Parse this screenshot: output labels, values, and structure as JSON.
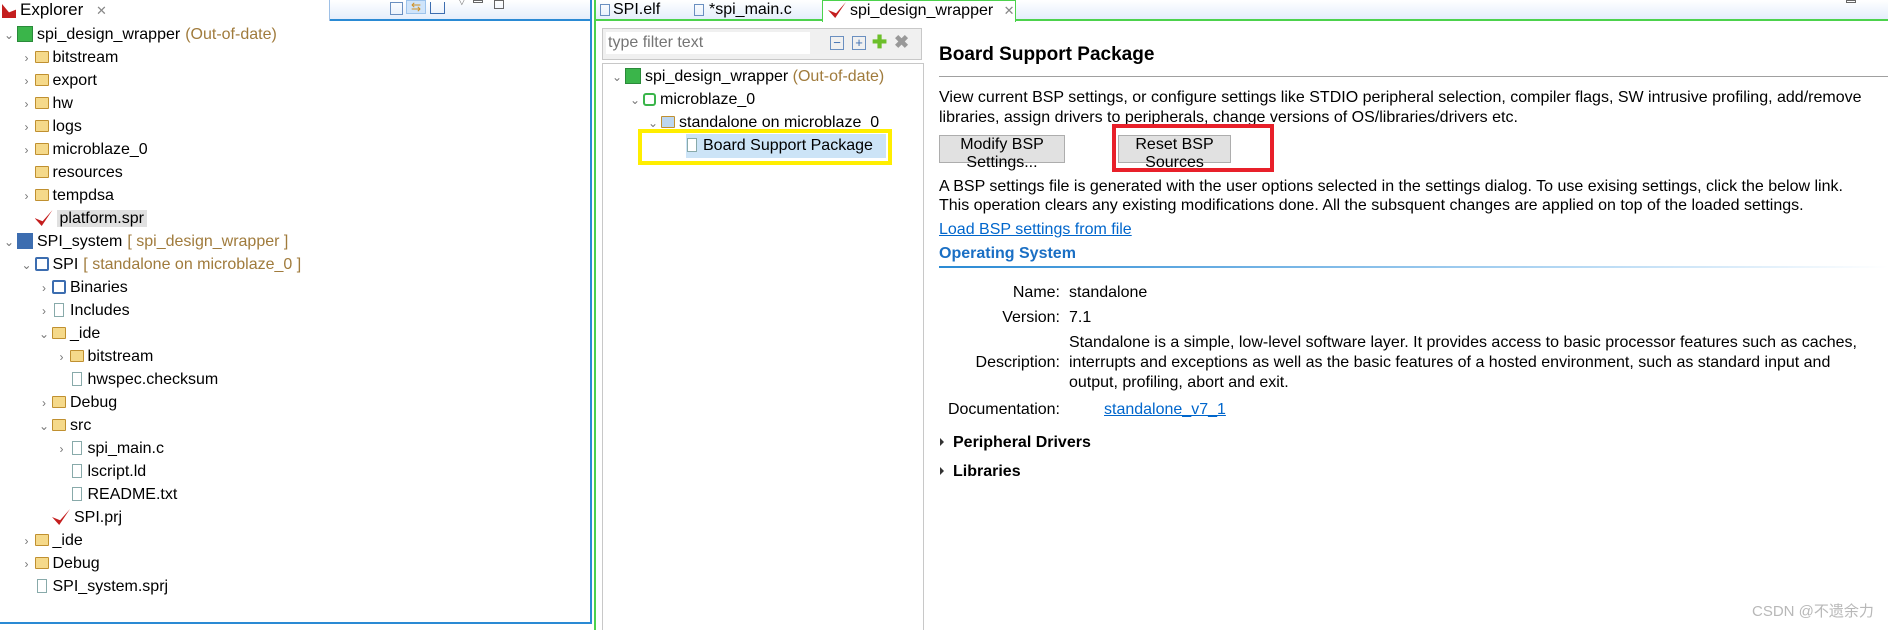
{
  "explorer": {
    "tab_label": "Explorer",
    "tree": [
      {
        "label": "spi_design_wrapper",
        "suffix": "(Out-of-date)",
        "level": 0,
        "expand": "open",
        "icon": "platform-project-icon"
      },
      {
        "label": "bitstream",
        "level": 1,
        "expand": "closed",
        "icon": "folder-icon"
      },
      {
        "label": "export",
        "level": 1,
        "expand": "closed",
        "icon": "folder-icon"
      },
      {
        "label": "hw",
        "level": 1,
        "expand": "closed",
        "icon": "folder-icon"
      },
      {
        "label": "logs",
        "level": 1,
        "expand": "closed",
        "icon": "folder-icon"
      },
      {
        "label": "microblaze_0",
        "level": 1,
        "expand": "closed",
        "icon": "folder-icon"
      },
      {
        "label": "resources",
        "level": 1,
        "expand": "none",
        "icon": "folder-icon"
      },
      {
        "label": "tempdsa",
        "level": 1,
        "expand": "closed",
        "icon": "folder-icon"
      },
      {
        "label": "platform.spr",
        "level": 1,
        "expand": "none",
        "icon": "xilinx-file-icon",
        "selected": true
      },
      {
        "label": "SPI_system",
        "suffix": "[ spi_design_wrapper ]",
        "level": 0,
        "expand": "open",
        "icon": "system-project-icon"
      },
      {
        "label": "SPI",
        "suffix": "[ standalone on microblaze_0 ]",
        "level": 1,
        "expand": "open",
        "icon": "application-project-icon"
      },
      {
        "label": "Binaries",
        "level": 2,
        "expand": "closed",
        "icon": "binaries-icon"
      },
      {
        "label": "Includes",
        "level": 2,
        "expand": "closed",
        "icon": "includes-icon"
      },
      {
        "label": "_ide",
        "level": 2,
        "expand": "open",
        "icon": "folder-icon"
      },
      {
        "label": "bitstream",
        "level": 3,
        "expand": "closed",
        "icon": "folder-icon"
      },
      {
        "label": "hwspec.checksum",
        "level": 3,
        "expand": "none",
        "icon": "file-icon"
      },
      {
        "label": "Debug",
        "level": 2,
        "expand": "closed",
        "icon": "folder-icon"
      },
      {
        "label": "src",
        "level": 2,
        "expand": "open",
        "icon": "folder-icon"
      },
      {
        "label": "spi_main.c",
        "level": 3,
        "expand": "closed",
        "icon": "c-file-icon"
      },
      {
        "label": "lscript.ld",
        "level": 3,
        "expand": "none",
        "icon": "linker-script-icon"
      },
      {
        "label": "README.txt",
        "level": 3,
        "expand": "none",
        "icon": "file-icon"
      },
      {
        "label": "SPI.prj",
        "level": 2,
        "expand": "none",
        "icon": "project-settings-icon"
      },
      {
        "label": "_ide",
        "level": 1,
        "expand": "closed",
        "icon": "folder-icon"
      },
      {
        "label": "Debug",
        "level": 1,
        "expand": "closed",
        "icon": "folder-icon"
      },
      {
        "label": "SPI_system.sprj",
        "level": 1,
        "expand": "none",
        "icon": "system-file-icon"
      }
    ]
  },
  "editor": {
    "tabs": [
      {
        "label": "SPI.elf",
        "icon": "elf-file-icon"
      },
      {
        "label": "*spi_main.c",
        "icon": "c-file-icon"
      },
      {
        "label": "spi_design_wrapper",
        "icon": "xilinx-file-icon",
        "active": true
      }
    ],
    "filter_placeholder": "type filter text",
    "tree": [
      {
        "label": "spi_design_wrapper",
        "suffix": "(Out-of-date)"
      },
      {
        "label": "microblaze_0"
      },
      {
        "label": "standalone on microblaze_0"
      },
      {
        "label": "Board Support Package",
        "selected": true
      }
    ],
    "content": {
      "title": "Board Support Package",
      "intro_1": "View current BSP settings, or configure settings like STDIO peripheral selection, compiler flags, SW intrusive profiling, add/remove",
      "intro_2": "libraries, assign drivers to peripherals, change versions of OS/libraries/drivers etc.",
      "modify_button": "Modify BSP Settings...",
      "reset_button": "Reset BSP Sources",
      "info_1": "A BSP settings file is generated with the user options selected in the settings dialog. To use exising settings, click the below link.",
      "info_2": "This operation clears any existing modifications done. All the subsquent changes are applied on top of the loaded settings.",
      "load_link": "Load BSP settings from file",
      "os_section": "Operating System",
      "name_label": "Name:",
      "name_value": "standalone",
      "version_label": "Version:",
      "version_value": "7.1",
      "description_label": "Description:",
      "description_1": "Standalone is a simple, low-level software layer. It provides access to basic processor features such as caches,",
      "description_2": "interrupts and exceptions as well as the basic features of a hosted environment, such as standard input and",
      "description_3": "output, profiling, abort and exit.",
      "documentation_label": "Documentation:",
      "documentation_link": "standalone_v7_1",
      "peripheral_drivers": "Peripheral Drivers",
      "libraries": "Libraries"
    }
  },
  "watermark": "CSDN @不遗余力",
  "colors": {
    "highlight_yellow": "#ffee00",
    "highlight_red": "#e8202a",
    "link": "#0066cc",
    "accent": "#2a8ad4"
  }
}
